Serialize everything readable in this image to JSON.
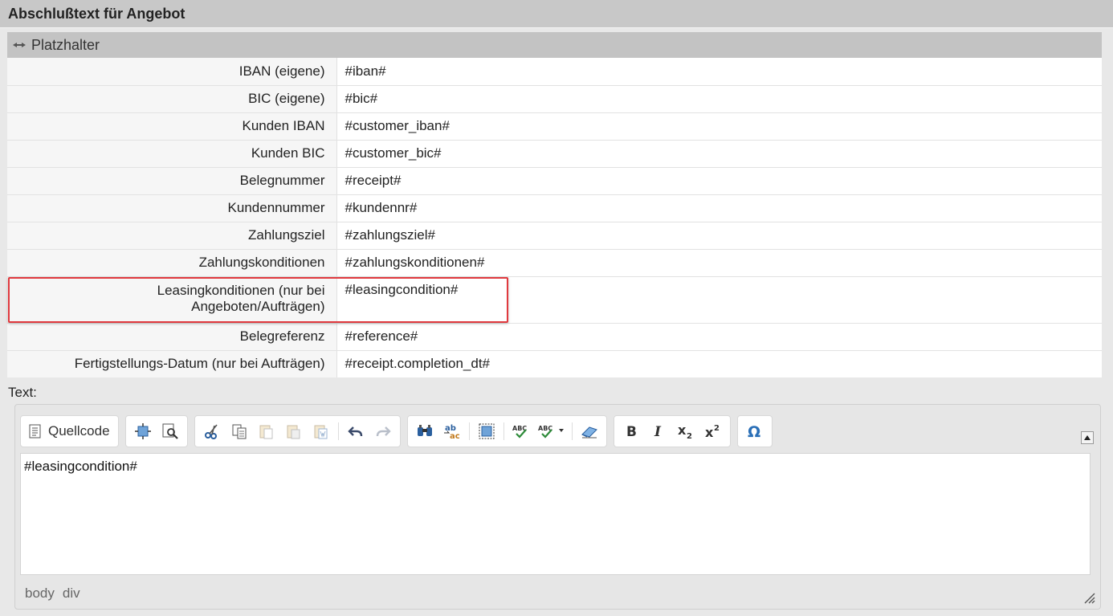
{
  "header": {
    "title": "Abschlußtext für Angebot"
  },
  "section": {
    "title": "Platzhalter"
  },
  "placeholders": [
    {
      "label": "IBAN (eigene)",
      "value": "#iban#"
    },
    {
      "label": "BIC (eigene)",
      "value": "#bic#"
    },
    {
      "label": "Kunden IBAN",
      "value": "#customer_iban#"
    },
    {
      "label": "Kunden BIC",
      "value": "#customer_bic#"
    },
    {
      "label": "Belegnummer",
      "value": "#receipt#"
    },
    {
      "label": "Kundennummer",
      "value": "#kundennr#"
    },
    {
      "label": "Zahlungsziel",
      "value": "#zahlungsziel#"
    },
    {
      "label": "Zahlungskonditionen",
      "value": "#zahlungskonditionen#"
    },
    {
      "label_line1": "Leasingkonditionen (nur bei",
      "label_line2": "Angeboten/Aufträgen)",
      "value": "#leasingcondition#"
    },
    {
      "label": "Belegreferenz",
      "value": "#reference#"
    },
    {
      "label": "Fertigstellungs-Datum (nur bei Aufträgen)",
      "value": "#receipt.completion_dt#"
    }
  ],
  "editor": {
    "field_label": "Text:",
    "source_button": "Quellcode",
    "content": "#leasingcondition#",
    "path": [
      "body",
      "div"
    ],
    "toolbar_icons": [
      "source-icon",
      "maximize-icon",
      "preview-icon",
      "cut-icon",
      "copy-icon",
      "paste-icon",
      "paste-text-icon",
      "paste-word-icon",
      "undo-icon",
      "redo-icon",
      "find-icon",
      "replace-icon",
      "select-all-icon",
      "spellcheck-icon",
      "scayt-icon",
      "remove-format-icon",
      "bold-icon",
      "italic-icon",
      "subscript-icon",
      "superscript-icon",
      "special-char-icon"
    ]
  },
  "colors": {
    "highlight": "#e0393e",
    "header_bg": "#c8c8c8",
    "accent": "#2a6fb7"
  }
}
